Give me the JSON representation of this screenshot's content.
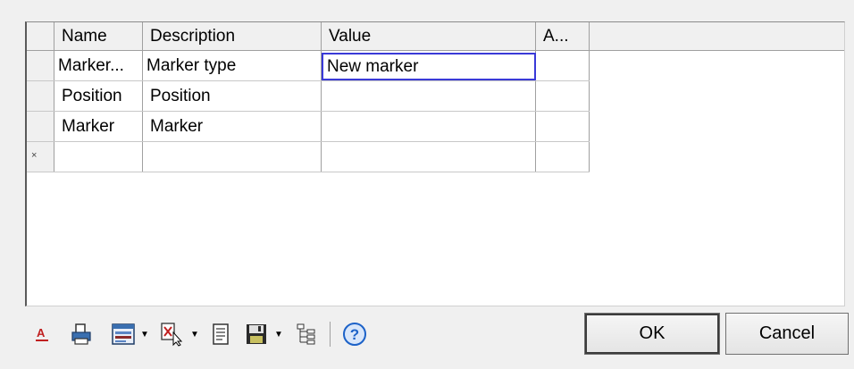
{
  "grid": {
    "columns": [
      "Name",
      "Description",
      "Value",
      "A..."
    ],
    "rows": [
      {
        "name": "Marker...",
        "description": "Marker type",
        "value": "New marker"
      },
      {
        "name": "Position",
        "description": "Position",
        "value": ""
      },
      {
        "name": "Marker",
        "description": "Marker",
        "value": ""
      }
    ],
    "new_row_marker": "×"
  },
  "toolbar": {
    "icons": [
      "font-icon",
      "print-icon",
      "view-layout-icon",
      "filter-delete-icon",
      "document-icon",
      "save-icon",
      "tree-view-icon",
      "help-icon"
    ],
    "help_glyph": "?"
  },
  "buttons": {
    "ok": "OK",
    "cancel": "Cancel"
  },
  "colors": {
    "selection_border": "#3a3ad8",
    "help_blue": "#1c62c8"
  }
}
